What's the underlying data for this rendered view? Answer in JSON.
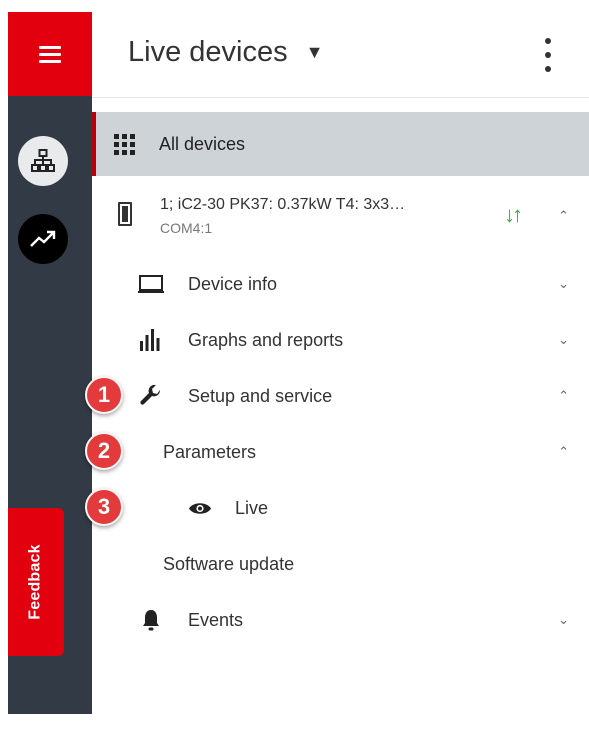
{
  "header": {
    "title": "Live devices"
  },
  "sidebar": {
    "feedback_label": "Feedback"
  },
  "all_devices": {
    "label": "All devices"
  },
  "device": {
    "name": "1; iC2-30 PK37: 0.37kW T4: 3x3…",
    "port": "COM4:1"
  },
  "menu": {
    "device_info": "Device info",
    "graphs": "Graphs and reports",
    "setup": "Setup and service",
    "parameters": "Parameters",
    "live": "Live",
    "software_update": "Software update",
    "events": "Events"
  },
  "badges": [
    "1",
    "2",
    "3"
  ],
  "colors": {
    "brand_red": "#e2000f",
    "rail": "#323a45",
    "selected": "#ced3d8",
    "status_green": "#2fb52f"
  }
}
